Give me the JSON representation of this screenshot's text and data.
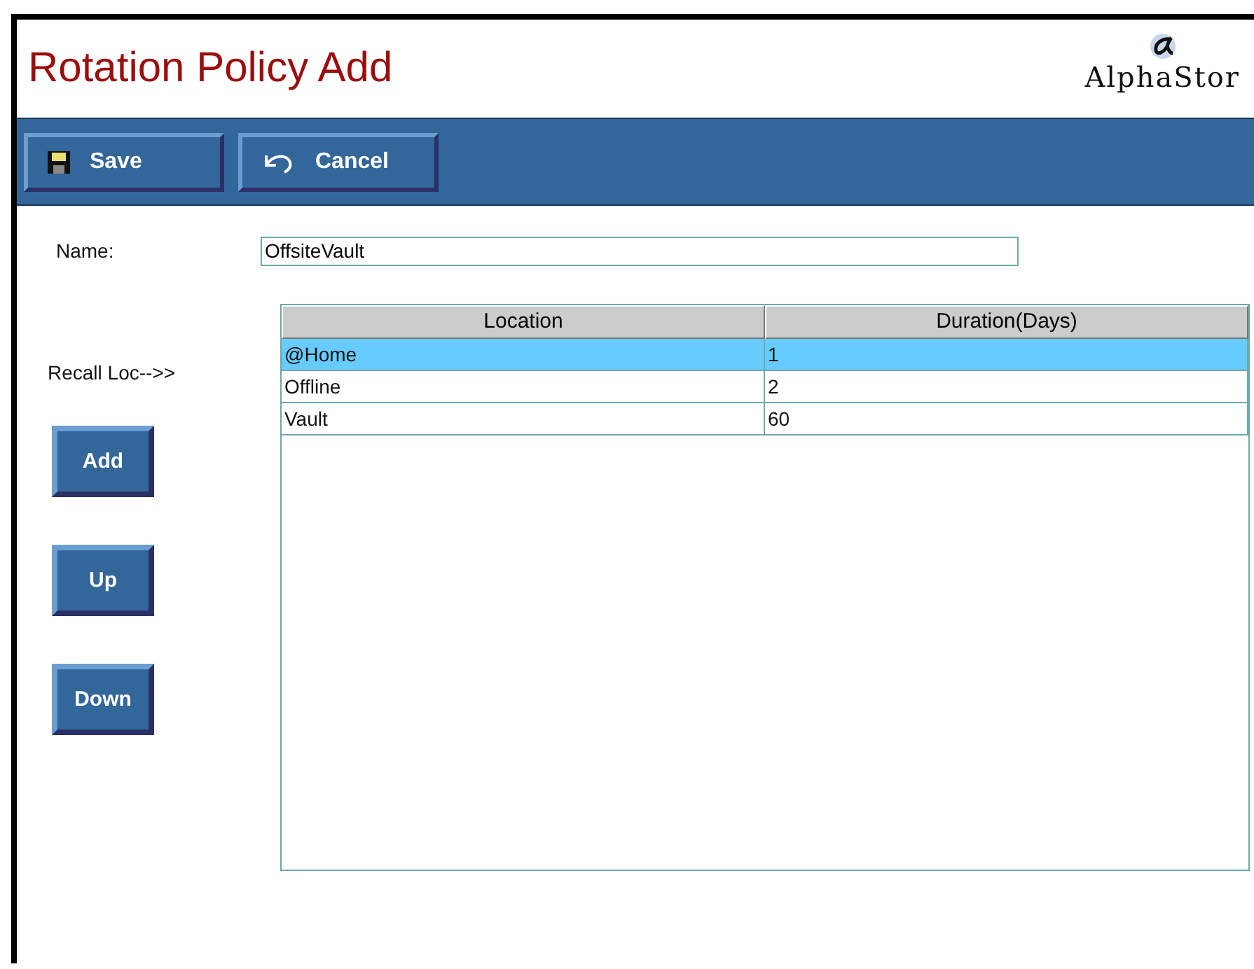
{
  "header": {
    "title": "Rotation Policy Add",
    "logo_text": "AlphaStor"
  },
  "toolbar": [
    {
      "label": "Save",
      "kind": "save"
    },
    {
      "label": "Cancel",
      "kind": "cancel"
    }
  ],
  "name_field": {
    "label": "Name:",
    "value": "OffsiteVault"
  },
  "recall_label": "Recall Loc-->>",
  "side_buttons": [
    "Add",
    "Up",
    "Down"
  ],
  "table": {
    "columns": [
      "Location",
      "Duration(Days)"
    ],
    "rows": [
      {
        "cells": [
          "@Home",
          "1"
        ],
        "selected": true
      },
      {
        "cells": [
          "Offline",
          "2"
        ],
        "selected": false
      },
      {
        "cells": [
          "Vault",
          "60"
        ],
        "selected": false
      }
    ]
  }
}
